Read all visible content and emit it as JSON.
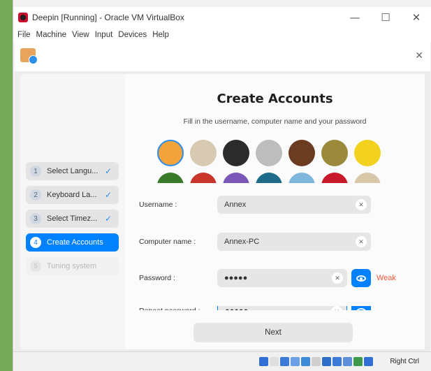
{
  "window": {
    "title": "Deepin [Running] - Oracle VM VirtualBox",
    "minimize_glyph": "—",
    "maximize_glyph": "☐",
    "close_glyph": "✕"
  },
  "menubar": [
    "File",
    "Machine",
    "View",
    "Input",
    "Devices",
    "Help"
  ],
  "installer": {
    "close_glyph": "✕",
    "steps": [
      {
        "num": "1",
        "label": "Select Langu...",
        "done": true,
        "state": "done"
      },
      {
        "num": "2",
        "label": "Keyboard La...",
        "done": true,
        "state": "done"
      },
      {
        "num": "3",
        "label": "Select Timez...",
        "done": true,
        "state": "done"
      },
      {
        "num": "4",
        "label": "Create Accounts",
        "done": false,
        "state": "active"
      },
      {
        "num": "5",
        "label": "Tuning system",
        "done": false,
        "state": "disabled"
      }
    ],
    "check_glyph": "✓",
    "title": "Create Accounts",
    "subtitle": "Fill in the username, computer name and your password",
    "avatars": {
      "colors": [
        "#f2a33a",
        "#d7c9b2",
        "#2b2b2b",
        "#bdbdbd",
        "#6b3b22",
        "#9b8a3c",
        "#f2d21f",
        "#3a7a2b",
        "#c9352b",
        "#7b58b8",
        "#1f6c8a",
        "#7fb6de",
        "#c8192a",
        "#d8c7a8"
      ],
      "selected_index": 0
    },
    "fields": {
      "username": {
        "label": "Username :",
        "value": "Annex"
      },
      "computer_name": {
        "label": "Computer name :",
        "value": "Annex-PC"
      },
      "password": {
        "label": "Password :",
        "value": "●●●●●",
        "strength": "Weak"
      },
      "repeat_password": {
        "label": "Repeat password :",
        "value": "●●●●●"
      }
    },
    "clear_glyph": "✕",
    "next_label": "Next"
  },
  "statusbar": {
    "host_key": "Right Ctrl",
    "icon_colors": [
      "#2f6fd6",
      "#dfdfdf",
      "#3b7ad9",
      "#6aa0e8",
      "#3b8bd8",
      "#cfcfcf",
      "#2e6fc7",
      "#3b7ad9",
      "#5d8fdb",
      "#3e9a4b",
      "#2f6fd6"
    ]
  }
}
